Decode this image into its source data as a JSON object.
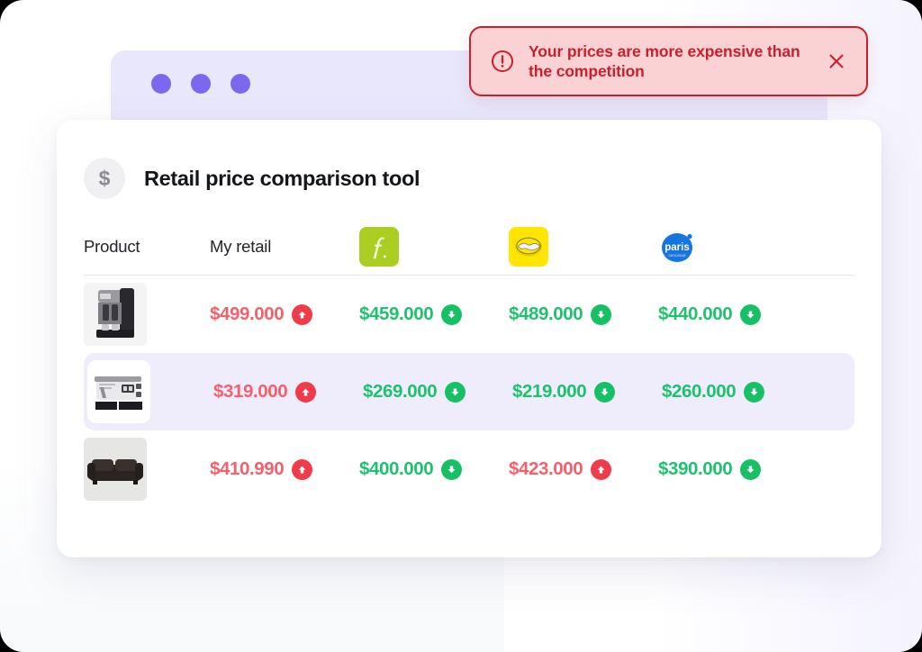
{
  "window": {
    "dots": [
      "dot-1",
      "dot-2",
      "dot-3"
    ]
  },
  "alert": {
    "message": "Your prices are more expensive than the competition",
    "icon": "exclamation-circle-icon",
    "close_label": "×",
    "border_color": "#c9202c",
    "background_color": "#fbd2d4",
    "text_color": "#c9202c"
  },
  "card": {
    "icon": "dollar-icon",
    "icon_glyph": "$",
    "title": "Retail price comparison tool"
  },
  "table": {
    "columns": [
      {
        "key": "product",
        "label": "Product",
        "type": "text"
      },
      {
        "key": "my_retail",
        "label": "My retail",
        "type": "text"
      },
      {
        "key": "falabella",
        "label": "",
        "type": "logo",
        "logo": "falabella-logo",
        "color": "#aace21"
      },
      {
        "key": "sodimac",
        "label": "",
        "type": "logo",
        "logo": "sodimac-logo",
        "color": "#ffe500"
      },
      {
        "key": "paris",
        "label": "",
        "type": "logo",
        "logo": "paris-logo",
        "color": "#1675e0"
      }
    ],
    "rows": [
      {
        "product_image": "coffee-machine-thumbnail",
        "highlighted": false,
        "prices": [
          {
            "value": "$499.000",
            "trend": "up",
            "arrow": "arrow-up-icon"
          },
          {
            "value": "$459.000",
            "trend": "down",
            "arrow": "arrow-down-icon"
          },
          {
            "value": "$489.000",
            "trend": "down",
            "arrow": "arrow-down-icon"
          },
          {
            "value": "$440.000",
            "trend": "down",
            "arrow": "arrow-down-icon"
          }
        ]
      },
      {
        "product_image": "sewing-machine-thumbnail",
        "highlighted": true,
        "prices": [
          {
            "value": "$319.000",
            "trend": "up",
            "arrow": "arrow-up-icon"
          },
          {
            "value": "$269.000",
            "trend": "down",
            "arrow": "arrow-down-icon"
          },
          {
            "value": "$219.000",
            "trend": "down",
            "arrow": "arrow-down-icon"
          },
          {
            "value": "$260.000",
            "trend": "down",
            "arrow": "arrow-down-icon"
          }
        ]
      },
      {
        "product_image": "sofa-thumbnail",
        "highlighted": false,
        "prices": [
          {
            "value": "$410.990",
            "trend": "up",
            "arrow": "arrow-up-icon"
          },
          {
            "value": "$400.000",
            "trend": "down",
            "arrow": "arrow-down-icon"
          },
          {
            "value": "$423.000",
            "trend": "up",
            "arrow": "arrow-up-icon"
          },
          {
            "value": "$390.000",
            "trend": "down",
            "arrow": "arrow-down-icon"
          }
        ]
      }
    ]
  },
  "colors": {
    "price_up": "#f4606b",
    "price_down": "#1ec26d",
    "arrow_up": "#ef3b4a",
    "arrow_down": "#17c065",
    "highlight_row": "#efecfb",
    "titlebar": "#e9e7fb",
    "dot": "#7b68ef"
  },
  "logos": {
    "falabella_mark": "f",
    "sodimac_mark": "handshake-icon",
    "paris_text": "paris",
    "paris_subtext": "cencosud"
  }
}
